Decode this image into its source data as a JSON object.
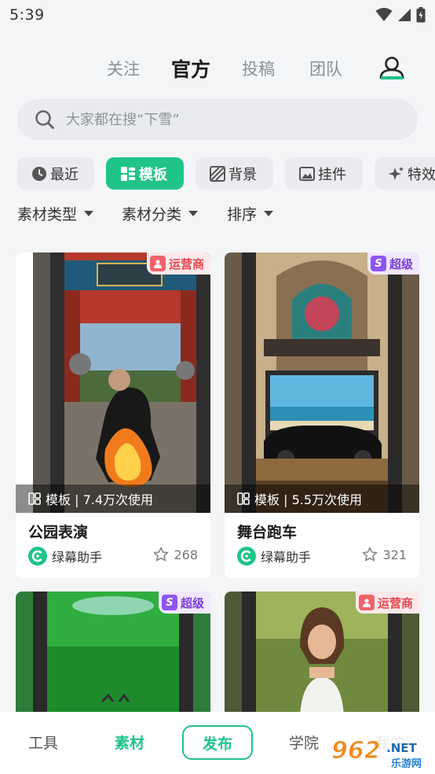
{
  "status_bar": {
    "time": "5:39"
  },
  "top_tabs": [
    {
      "label": "关注",
      "active": false
    },
    {
      "label": "官方",
      "active": true
    },
    {
      "label": "投稿",
      "active": false
    },
    {
      "label": "团队",
      "active": false
    }
  ],
  "search": {
    "placeholder": "大家都在搜“下雪”"
  },
  "categories": [
    {
      "label": "最近",
      "icon": "clock-icon"
    },
    {
      "label": "模板",
      "icon": "template-icon",
      "active": true
    },
    {
      "label": "背景",
      "icon": "background-icon"
    },
    {
      "label": "挂件",
      "icon": "image-icon"
    },
    {
      "label": "特效",
      "icon": "sparkle-icon"
    }
  ],
  "filters": [
    {
      "label": "素材类型"
    },
    {
      "label": "素材分类"
    },
    {
      "label": "排序"
    }
  ],
  "cards": [
    {
      "badge": "运营商",
      "badge_icon_char": "",
      "badge_type": "operator",
      "usage": "模板 | 7.4万次使用",
      "title": "公园表演",
      "author": "绿幕助手",
      "likes": "268"
    },
    {
      "badge": "超级",
      "badge_icon_char": "S",
      "badge_type": "super",
      "usage": "模板 | 5.5万次使用",
      "title": "舞台跑车",
      "author": "绿幕助手",
      "likes": "321"
    },
    {
      "badge": "超级",
      "badge_icon_char": "S",
      "badge_type": "super",
      "usage": "",
      "title": "",
      "author": "",
      "likes": ""
    },
    {
      "badge": "运营商",
      "badge_icon_char": "",
      "badge_type": "operator",
      "usage": "",
      "title": "",
      "author": "",
      "likes": ""
    }
  ],
  "bottom_nav": [
    {
      "label": "工具",
      "active": false
    },
    {
      "label": "素材",
      "active": true
    },
    {
      "label": "发布",
      "active": false
    },
    {
      "label": "学院",
      "active": false
    },
    {
      "label": "我的",
      "active": false
    }
  ],
  "watermark": {
    "number": "962",
    "suffix": ".NET",
    "caption": "乐游网"
  },
  "colors": {
    "accent": "#1fc489",
    "operator_badge": "#e5454f",
    "super_badge": "#7b3fd9"
  }
}
